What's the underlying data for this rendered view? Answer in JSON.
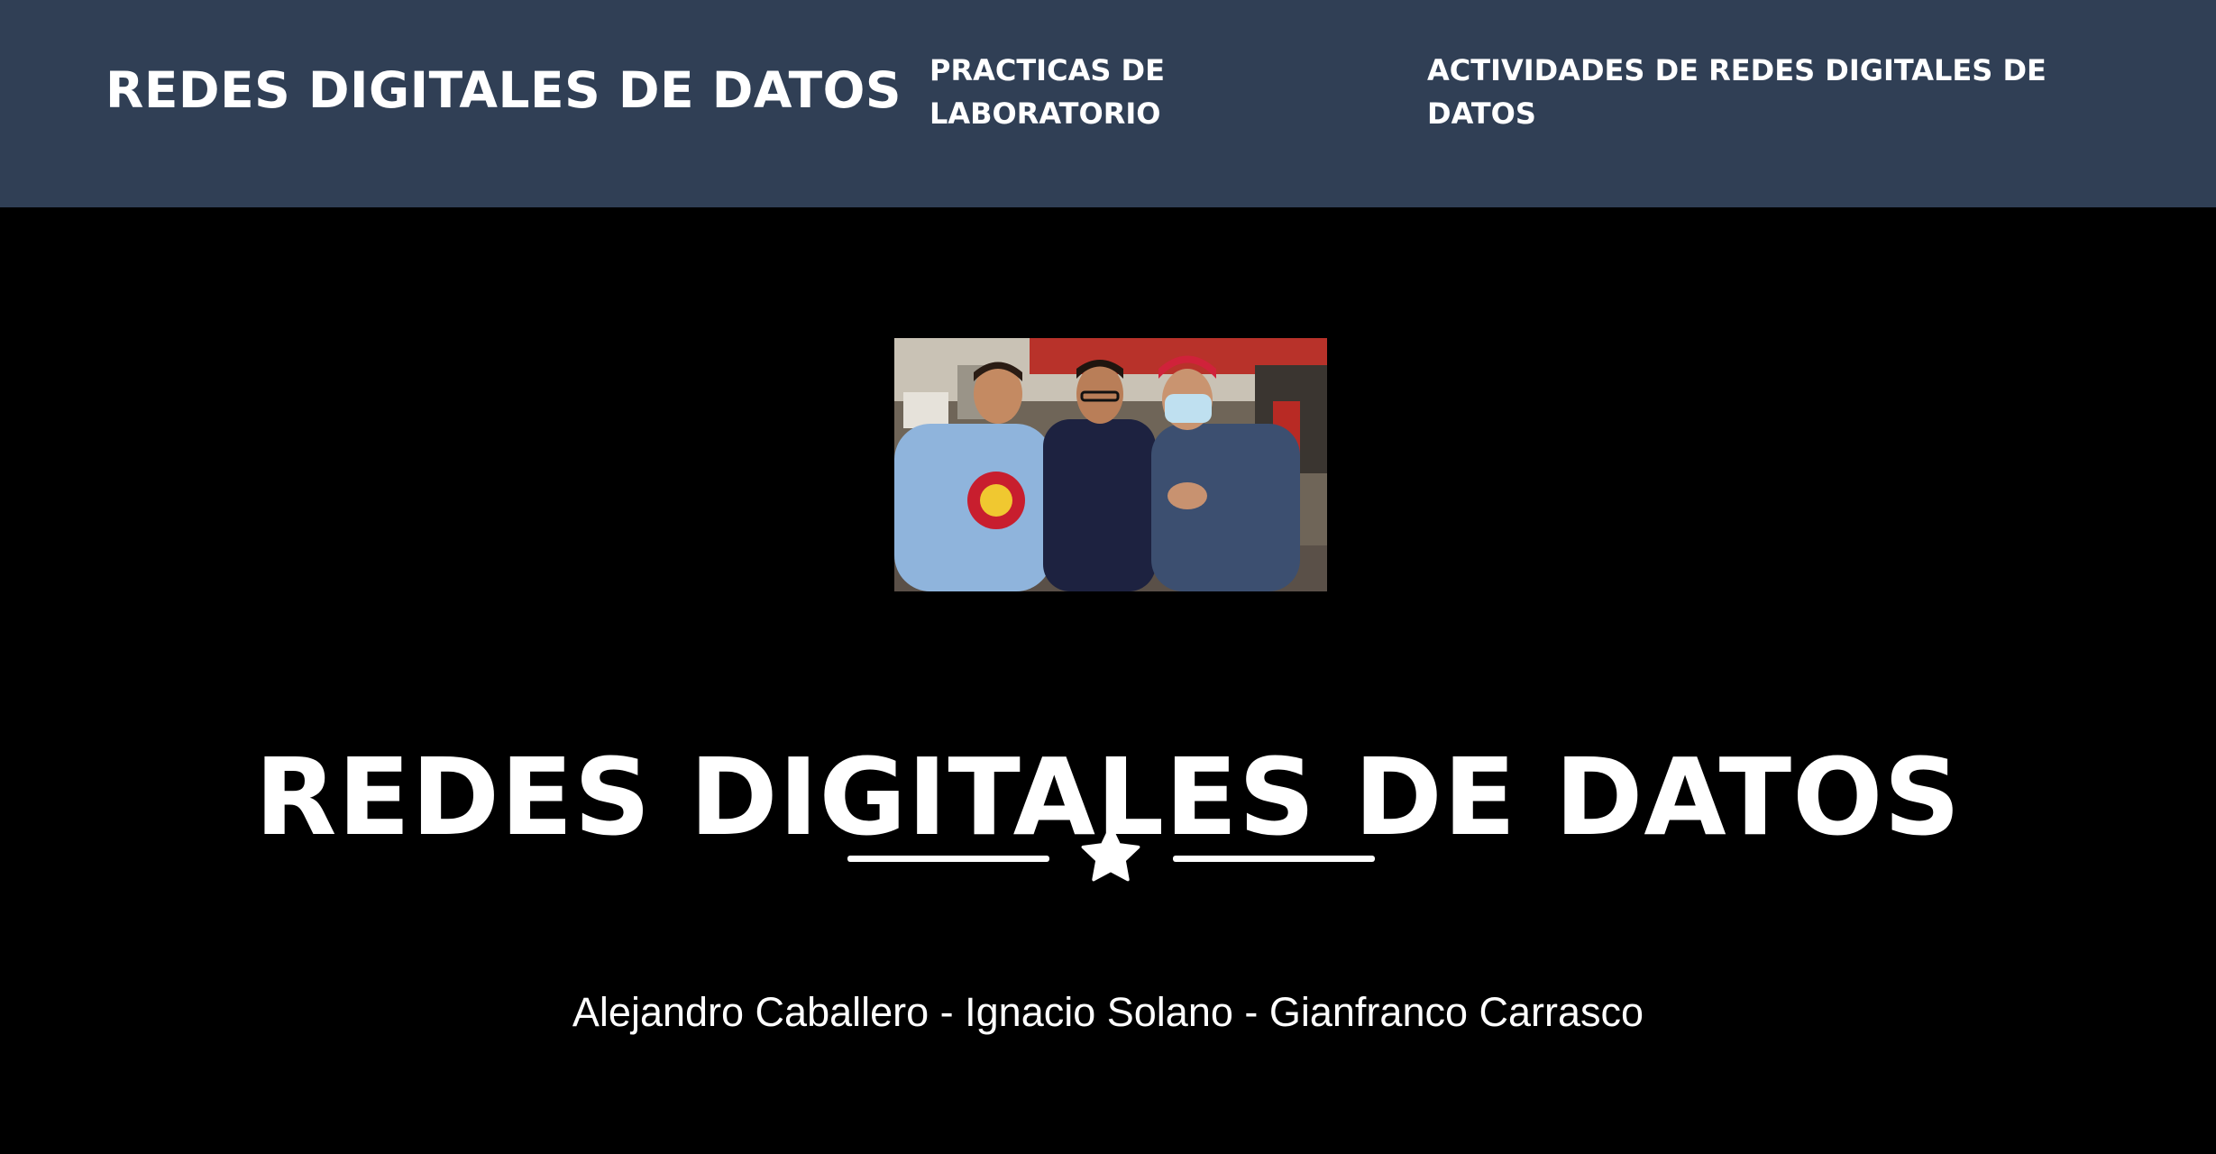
{
  "navbar": {
    "brand": "REDES DIGITALES DE DATOS",
    "links": [
      {
        "label": "PRACTICAS DE LABORATORIO"
      },
      {
        "label": "ACTIVIDADES DE REDES DIGITALES DE DATOS"
      }
    ]
  },
  "masthead": {
    "title": "REDES DIGITALES DE DATOS",
    "divider_icon": "star-icon",
    "subtitle": "Alejandro Caballero - Ignacio Solano - Gianfranco Carrasco"
  },
  "colors": {
    "navbar_bg": "#303f55",
    "masthead_bg": "#000000",
    "text": "#ffffff"
  }
}
